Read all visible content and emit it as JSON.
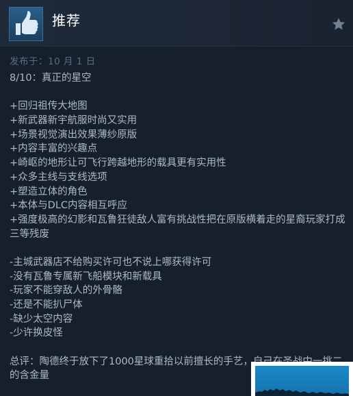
{
  "header": {
    "title": "推荐",
    "thumb_icon": "thumbs-up-icon",
    "star_icon": "star-icon"
  },
  "posted": "发布于：10 月 1 日",
  "review": {
    "rating_line": "8/10：真正的星空",
    "pros": [
      "+回归祖传大地图",
      "+新武器新宇航服时尚又实用",
      "+场景视觉演出效果薄纱原版",
      "+内容丰富的兴趣点",
      "+崎岖的地形让可飞行跨越地形的载具更有实用性",
      "+众多主线与支线选项",
      "+塑造立体的角色",
      "+本体与DLC内容相互呼应",
      "+强度极高的幻影和瓦鲁狂徒敌人富有挑战性把在原版横着走的星裔玩家打成三等残废"
    ],
    "cons": [
      "-主城武器店不给购买许可也不说上哪获得许可",
      "-没有瓦鲁专属新飞船模块和新载具",
      "-玩家不能穿敌人的外骨骼",
      "-还是不能扒尸体",
      "-缺少太空内容",
      "-少许换皮怪"
    ],
    "summary": "总评：陶德终于放下了1000星球重拾以前擅长的手艺，自己在圣战中一挑二的含金量"
  },
  "colors": {
    "background": "#16202d",
    "header_bg": "#1e2a3a",
    "thumb_bg": "#2a5f8a",
    "text": "#acb9c4",
    "muted": "#56707f"
  }
}
